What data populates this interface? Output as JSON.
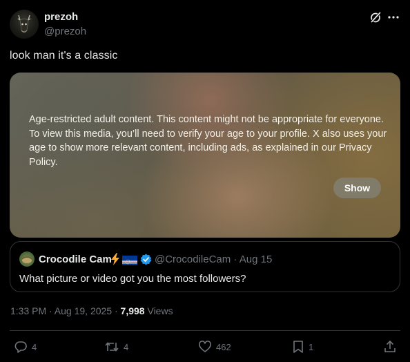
{
  "author": {
    "name": "prezoh",
    "handle": "@prezoh"
  },
  "tweet": {
    "text": "look man it's a classic"
  },
  "media": {
    "notice": "Age-restricted adult content. This content might not be appropriate for everyone. To view this media, you’ll need to verify your age to your profile. X also uses your age to show more relevant content, including ads, as explained in our Privacy Policy.",
    "show_label": "Show"
  },
  "quote": {
    "name": "Crocodile Cam",
    "handle_and_date": "@CrocodileCam · Aug 15",
    "text": "What picture or video got you the most followers?"
  },
  "meta": {
    "time": "1:33 PM · Aug 19, 2025 · ",
    "views_count": "7,998",
    "views_label": " Views"
  },
  "actions": {
    "replies": "4",
    "reposts": "4",
    "likes": "462",
    "bookmarks": "1"
  },
  "icons": {
    "header": [
      "grok-icon",
      "more-icon"
    ],
    "quote": [
      "bolt-icon",
      "cape-verde-flag-icon",
      "verified-icon"
    ],
    "actions": [
      "reply-icon",
      "repost-icon",
      "like-icon",
      "bookmark-icon",
      "share-icon"
    ]
  },
  "colors": {
    "background": "#000000",
    "text": "#e7e9ea",
    "secondary": "#71767b",
    "border": "#2f3336",
    "verified": "#1d9bf0"
  }
}
